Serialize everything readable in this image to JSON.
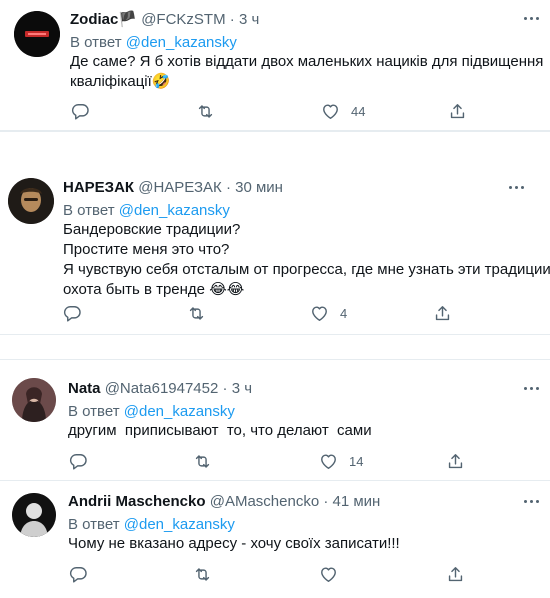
{
  "reply_prefix": "В ответ",
  "tweets": [
    {
      "name": "Zodiac🏴",
      "handle": "@FCKzSTM",
      "time": "3 ч",
      "reply_to": "@den_kazansky",
      "lines": [
        "Де саме? Я б хотів віддати двох маленьких нациків для підвищення",
        "кваліфікації🤣"
      ],
      "likes": "44"
    },
    {
      "name": "НАРЕЗАК",
      "handle": "@НАРЕЗАК",
      "time": "30 мин",
      "reply_to": "@den_kazansky",
      "lines": [
        "Бандеровские традиции?",
        "Простите меня это что?",
        "Я чувствую себя отсталым от прогресса, где мне узнать эти традиции,",
        "охота быть в тренде 😂😂"
      ],
      "likes": "4"
    },
    {
      "name": "Nata",
      "handle": "@Nata61947452",
      "time": "3 ч",
      "reply_to": "@den_kazansky",
      "lines": [
        "другим  приписывают  то, что делают  сами"
      ],
      "likes": "14"
    },
    {
      "name": "Andrii Maschencko",
      "handle": "@AMaschencko",
      "time": "41 мин",
      "reply_to": "@den_kazansky",
      "lines": [
        "Чому не вказано адресу - хочу своїх записати!!!"
      ],
      "likes": ""
    }
  ]
}
